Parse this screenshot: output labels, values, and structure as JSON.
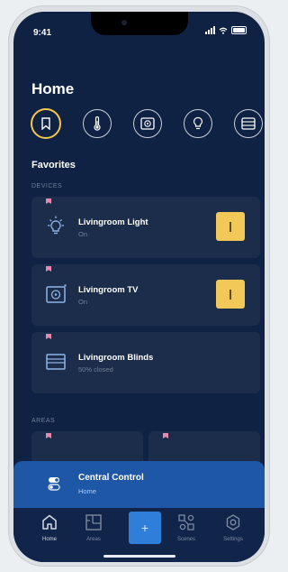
{
  "status_bar": {
    "time": "9:41"
  },
  "page": {
    "title": "Home"
  },
  "categories": [
    {
      "name": "favorites",
      "icon": "bookmark-icon",
      "active": true
    },
    {
      "name": "climate",
      "icon": "thermometer-icon"
    },
    {
      "name": "media",
      "icon": "tv-icon"
    },
    {
      "name": "lights",
      "icon": "lightbulb-icon"
    },
    {
      "name": "blinds",
      "icon": "blinds-icon"
    }
  ],
  "favorites": {
    "title": "Favorites",
    "devices_label": "DEVICES",
    "devices": [
      {
        "name": "Livingroom Light",
        "state": "On",
        "icon": "lightbulb-icon",
        "has_toggle": true
      },
      {
        "name": "Livingroom TV",
        "state": "On",
        "icon": "tv-icon",
        "has_toggle": true
      },
      {
        "name": "Livingroom Blinds",
        "state": "50% closed",
        "icon": "blinds-icon",
        "has_toggle": false
      }
    ],
    "areas_label": "AREAS"
  },
  "central_control": {
    "title": "Central Control",
    "subtitle": "Home"
  },
  "tabs": [
    {
      "label": "Home",
      "icon": "home-icon",
      "active": true
    },
    {
      "label": "Areas",
      "icon": "floorplan-icon"
    },
    {
      "label": "",
      "icon": "plus-icon"
    },
    {
      "label": "Scenes",
      "icon": "scenes-icon"
    },
    {
      "label": "Settings",
      "icon": "gear-icon"
    }
  ],
  "colors": {
    "background": "#0f2244",
    "card": "#1c2d4c",
    "accent_yellow": "#f2c959",
    "central_control": "#1d57a6",
    "add_button": "#2f7ed9",
    "bookmark_pink": "#e48ab0"
  }
}
